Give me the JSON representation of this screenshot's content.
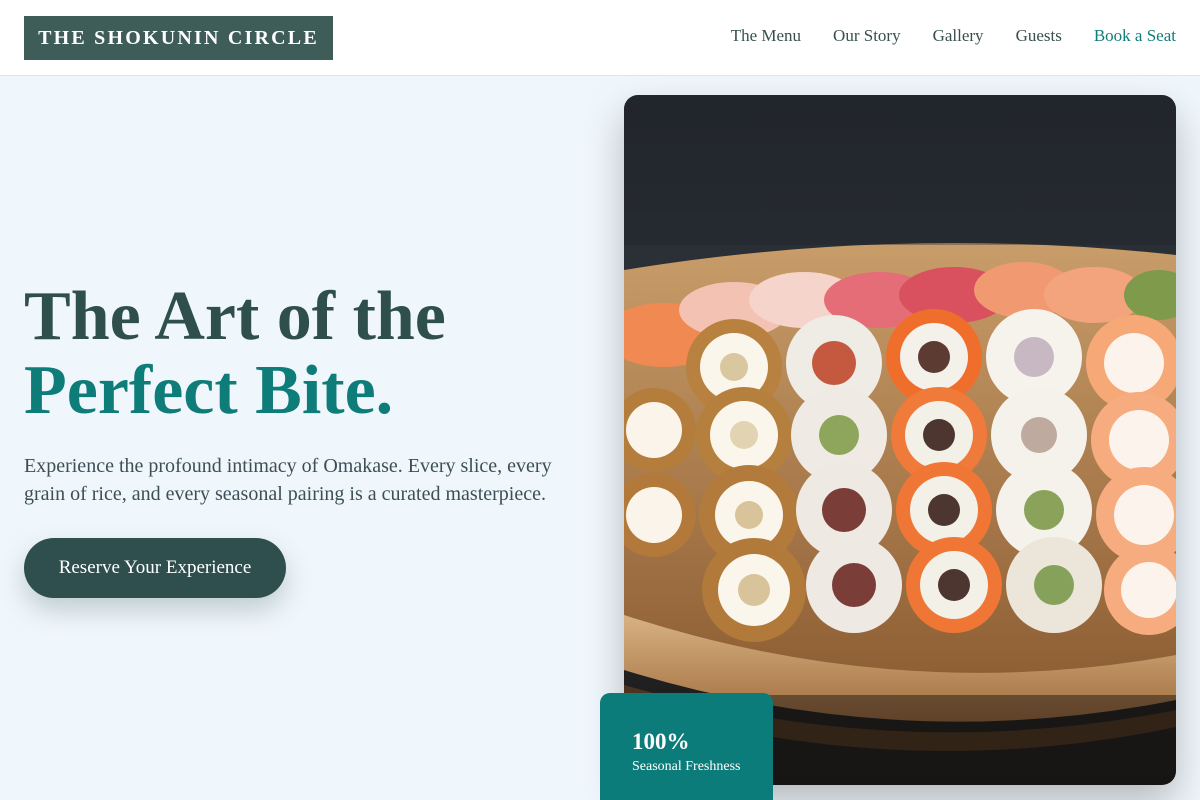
{
  "header": {
    "brand": "THE SHOKUNIN CIRCLE",
    "nav": [
      {
        "label": "The Menu"
      },
      {
        "label": "Our Story"
      },
      {
        "label": "Gallery"
      },
      {
        "label": "Guests"
      },
      {
        "label": "Book a Seat"
      }
    ]
  },
  "hero": {
    "title_line1": "The Art of the",
    "title_line2": "Perfect Bite.",
    "description": "Experience the profound intimacy of Omakase. Every slice, every grain of rice, and every seasonal pairing is a curated masterpiece.",
    "cta_label": "Reserve Your Experience"
  },
  "image": {
    "alt": "Wooden boat platter filled with nigiri and sushi rolls"
  },
  "stat": {
    "value": "100%",
    "label": "Seasonal Freshness"
  },
  "colors": {
    "brand_dark": "#2e4f4e",
    "accent_teal": "#0e7c79",
    "background": "#f0f7fc"
  }
}
